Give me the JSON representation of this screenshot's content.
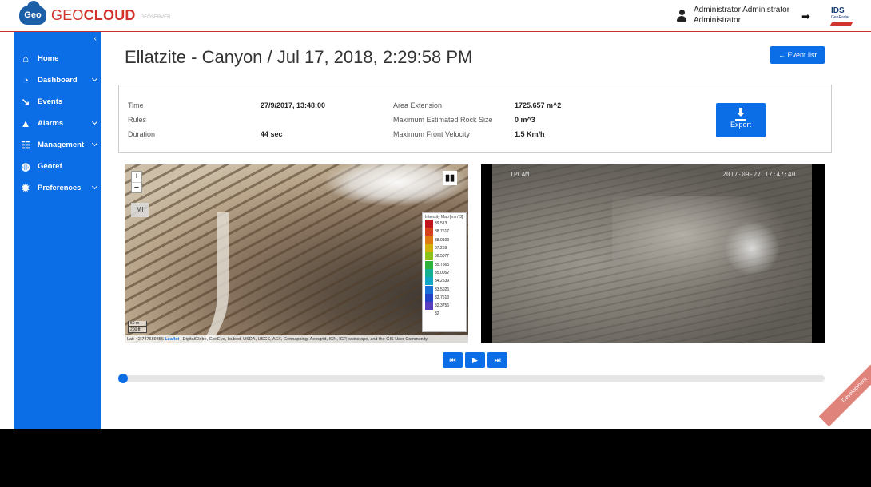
{
  "header": {
    "logo_icon_text": "Geo",
    "logo_text_light": "GEO",
    "logo_text_bold": "CLOUD",
    "logo_sub": "GEOSERVER",
    "user_name": "Administrator Administrator",
    "user_role": "Administrator",
    "ids_logo": "IDS",
    "ids_sub": "GeoRadar"
  },
  "sidebar": {
    "collapse_icon": "‹",
    "items": [
      {
        "label": "Home",
        "icon": "home-icon",
        "glyph": "⌂",
        "has_submenu": false
      },
      {
        "label": "Dashboard",
        "icon": "dashboard-icon",
        "glyph": "◔",
        "has_submenu": true
      },
      {
        "label": "Events",
        "icon": "events-icon",
        "glyph": "↘",
        "has_submenu": false
      },
      {
        "label": "Alarms",
        "icon": "alarm-icon",
        "glyph": "▲",
        "has_submenu": true
      },
      {
        "label": "Management",
        "icon": "management-icon",
        "glyph": "☷",
        "has_submenu": true
      },
      {
        "label": "Georef",
        "icon": "globe-icon",
        "glyph": "◍",
        "has_submenu": false
      },
      {
        "label": "Preferences",
        "icon": "gear-icon",
        "glyph": "✹",
        "has_submenu": true
      }
    ]
  },
  "main": {
    "title": "Ellatzite - Canyon / Jul 17, 2018, 2:29:58 PM",
    "event_list_button": "← Event list",
    "info": {
      "time_label": "Time",
      "time_value": "27/9/2017, 13:48:00",
      "rules_label": "Rules",
      "rules_value": "",
      "duration_label": "Duration",
      "duration_value": "44 sec",
      "area_label": "Area Extension",
      "area_value": "1725.657 m^2",
      "rock_label": "Maximum Estimated Rock Size",
      "rock_value": "0 m^3",
      "velocity_label": "Maximum Front Velocity",
      "velocity_value": "1.5 Km/h"
    },
    "export_button": "Export"
  },
  "map": {
    "zoom_in": "+",
    "zoom_out": "−",
    "mi_button": "MI",
    "layers_icon": "layers-icon",
    "legend_title": "Intensity Map [mm^3]",
    "legend": [
      {
        "value": "39.513",
        "color": "#c0141e"
      },
      {
        "value": "38.7617",
        "color": "#d6401a"
      },
      {
        "value": "38.0103",
        "color": "#e07a12"
      },
      {
        "value": "37.259",
        "color": "#d4b20c"
      },
      {
        "value": "36.5077",
        "color": "#8cc21a"
      },
      {
        "value": "35.7565",
        "color": "#2cb23a"
      },
      {
        "value": "35.0052",
        "color": "#13b092"
      },
      {
        "value": "34.2539",
        "color": "#12a6c6"
      },
      {
        "value": "33.5026",
        "color": "#1b6fd6"
      },
      {
        "value": "32.7513",
        "color": "#2242c8"
      },
      {
        "value": "32.3756",
        "color": "#5a3ec0"
      },
      {
        "value": "32",
        "color": "#ffffff"
      }
    ],
    "scale_metric": "50 m",
    "scale_imperial": "200 ft",
    "attribution_prefix": "Lat: 42.747689356",
    "attribution_link": "Leaflet",
    "attribution_text": "| DigitalGlobe, GeoEye, Icubed, USDA, USGS, AEX, Getmapping, Aerogrid, IGN, IGP, swisstopo, and the GIS User Community"
  },
  "video": {
    "camera_label": "TPCAM",
    "timestamp": "2017-09-27 17:47:40"
  },
  "playback": {
    "prev_label": "⏮",
    "play_label": "▶",
    "next_label": "⏭",
    "progress": 0
  },
  "ribbon": "Development"
}
